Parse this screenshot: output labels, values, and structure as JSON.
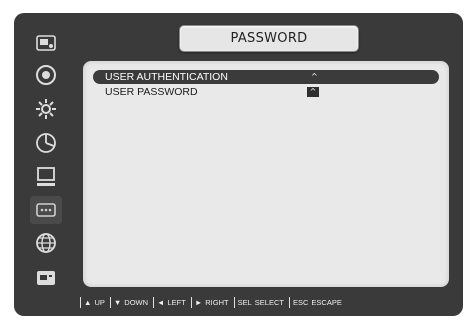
{
  "header": {
    "title": "PASSWORD"
  },
  "sidebar": {
    "icons": [
      "camera-icon",
      "record-disc-icon",
      "settings-gear-icon",
      "schedule-pie-icon",
      "monitor-icon",
      "password-keypad-icon",
      "network-globe-icon",
      "system-card-icon"
    ],
    "active_index": 5
  },
  "menu": {
    "items": [
      {
        "label": "USER AUTHENTICATION",
        "value": "^"
      },
      {
        "label": "USER PASSWORD",
        "value": "^"
      }
    ]
  },
  "footer": {
    "keys": [
      {
        "key": "▲",
        "action": "UP"
      },
      {
        "key": "▼",
        "action": "DOWN"
      },
      {
        "key": "◄",
        "action": "LEFT"
      },
      {
        "key": "►",
        "action": "RIGHT"
      },
      {
        "key": "SEL",
        "action": "SELECT"
      },
      {
        "key": "ESC",
        "action": "ESCAPE"
      }
    ]
  },
  "colors": {
    "screen_bg": "#3a3a3a",
    "panel_bg": "#e9e9e9",
    "selected_row": "#3b3b3b",
    "tab_bg": "#e6e6e6"
  }
}
